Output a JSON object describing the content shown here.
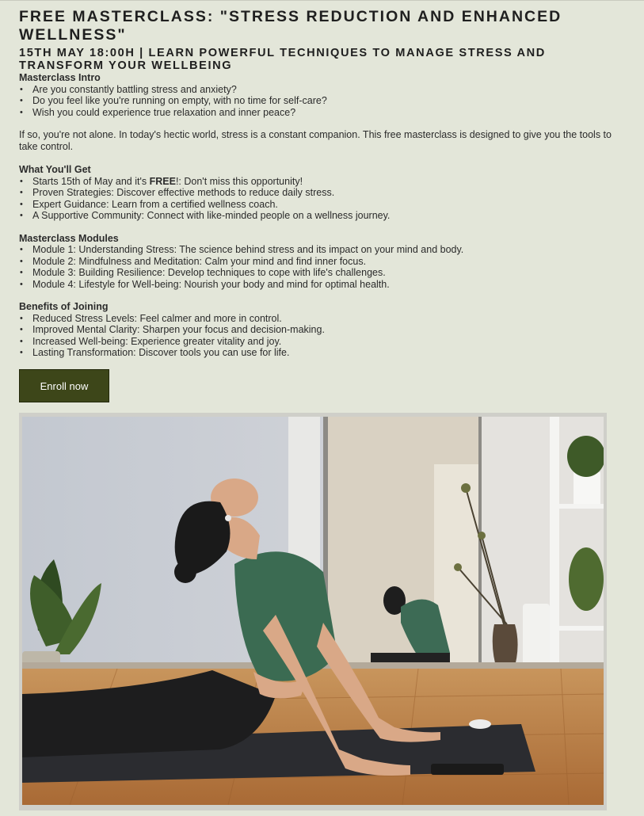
{
  "title": "FREE MASTERCLASS: \"STRESS REDUCTION AND ENHANCED WELLNESS\"",
  "subtitle": "15TH MAY 18:00H | LEARN POWERFUL TECHNIQUES TO MANAGE STRESS AND TRANSFORM YOUR WELLBEING",
  "intro": {
    "heading": "Masterclass Intro",
    "items": [
      "Are you constantly battling stress and anxiety?",
      "Do you feel like you're running on empty, with no time for self-care?",
      "Wish you could experience true relaxation and inner peace?"
    ],
    "paragraph": "If so, you're not alone. In today's hectic world, stress is a constant companion. This free masterclass is designed to give you the tools to take control."
  },
  "get": {
    "heading": "What You'll Get",
    "first_prefix": "Starts 15th of May and it's ",
    "first_bold": "FREE",
    "first_suffix": "!: Don't miss this opportunity!",
    "items": [
      "Proven Strategies: Discover effective methods to reduce daily stress.",
      "Expert Guidance: Learn from a certified wellness coach.",
      "A Supportive Community: Connect with like-minded people on a wellness journey."
    ]
  },
  "modules": {
    "heading": "Masterclass Modules",
    "items": [
      "Module 1: Understanding Stress: The science behind stress and its impact on your mind and body.",
      "Module 2: Mindfulness and Meditation: Calm your mind and find inner focus.",
      "Module 3: Building Resilience: Develop techniques to cope with life's challenges.",
      "Module 4: Lifestyle for Well-being: Nourish your body and mind for optimal health."
    ]
  },
  "benefits": {
    "heading": "Benefits of Joining",
    "items": [
      "Reduced Stress Levels: Feel calmer and more in control.",
      "Improved Mental Clarity: Sharpen your focus and decision-making.",
      "Increased Well-being: Experience greater vitality and joy.",
      "Lasting Transformation: Discover tools you can use for life."
    ]
  },
  "enroll_label": "Enroll now",
  "colors": {
    "background": "#e3e6d9",
    "button": "#3d4619",
    "text": "#2b2b2b"
  }
}
